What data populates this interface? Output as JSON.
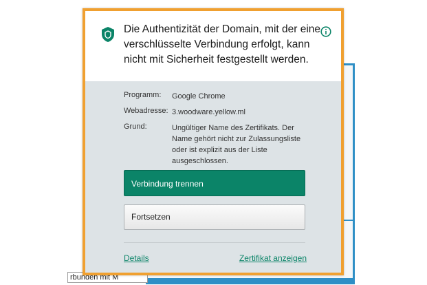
{
  "background": {
    "status_fragment": "rbunden mit M"
  },
  "popup": {
    "border_color": "#f0a030",
    "accent_color": "#0b8468",
    "header_text": "Die Authentizität der Domain, mit der eine verschlüsselte Verbindung erfolgt, kann nicht mit Sicherheit festgestellt werden.",
    "details": {
      "program_label": "Programm:",
      "program_value": "Google Chrome",
      "address_label": "Webadresse:",
      "address_value": "3.woodware.yellow.ml",
      "reason_label": "Grund:",
      "reason_value": "Ungültiger Name des Zertifikats. Der Name gehört nicht zur Zulassungsliste oder ist explizit aus der Liste ausgeschlossen."
    },
    "disconnect_button": "Verbindung trennen",
    "continue_button": "Fortsetzen",
    "details_link": "Details",
    "certificate_link": "Zertifikat anzeigen",
    "icons": {
      "shield": "shield-icon",
      "info": "info-icon"
    }
  }
}
